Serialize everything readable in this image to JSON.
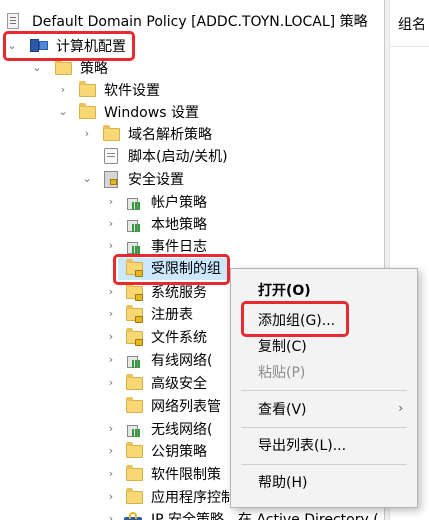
{
  "tree": {
    "root": "Default Domain Policy [ADDC.TOYN.LOCAL] 策略",
    "computer_config": "计算机配置",
    "policies": "策略",
    "software_settings": "软件设置",
    "windows_settings": "Windows 设置",
    "name_resolution": "域名解析策略",
    "scripts": "脚本(启动/关机)",
    "security_settings": "安全设置",
    "account_policies": "帐户策略",
    "local_policies": "本地策略",
    "event_log": "事件日志",
    "restricted_groups": "受限制的组",
    "system_services": "系统服务",
    "registry": "注册表",
    "file_system": "文件系统",
    "wired_network": "有线网络(",
    "advanced_security": "高级安全",
    "network_list": "网络列表管",
    "wireless_network": "无线网络(",
    "public_key": "公钥策略",
    "software_restriction": "软件限制策",
    "app_control": "应用程序控制策略",
    "ipsec": "IP 安全策略，在 Active Directory ("
  },
  "right_pane": {
    "column_header": "组名"
  },
  "context_menu": {
    "items": [
      {
        "label": "打开(O)"
      },
      {
        "label": "添加组(G)..."
      },
      {
        "label": "复制(C)"
      },
      {
        "label": "粘贴(P)"
      },
      {
        "label": "查看(V)"
      },
      {
        "label": "导出列表(L)..."
      },
      {
        "label": "帮助(H)"
      }
    ]
  },
  "colors": {
    "highlight": "#cce8ff",
    "annotation_red": "#e8292e"
  }
}
